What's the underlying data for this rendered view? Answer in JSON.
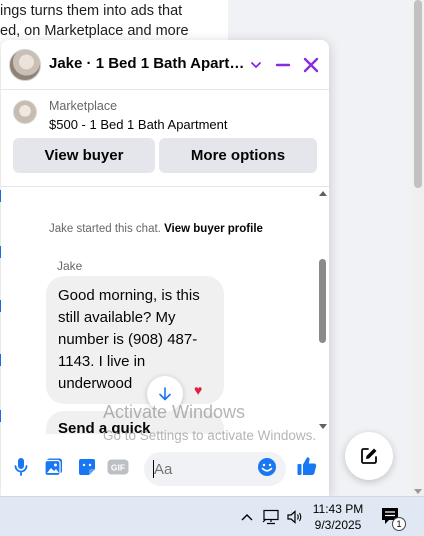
{
  "background": {
    "lines": [
      "ings turns them into ads that",
      "ed, on Marketplace and more"
    ]
  },
  "chat": {
    "title": "Jake · 1 Bed 1 Bath Apartm…",
    "listing": {
      "label": "Marketplace",
      "title": "$500 - 1 Bed 1 Bath Apartment"
    },
    "buttons": {
      "view_buyer": "View buyer",
      "more_options": "More options"
    },
    "system_text": "Jake started this chat.",
    "system_link": "View buyer profile",
    "sender": "Jake",
    "message": "Good morning, is this still available? My number is (908) 487-1143. I live in underwood",
    "reaction": "♥",
    "partial_message": "Send a quick",
    "composer_placeholder": "Aa",
    "accent_color": "#8a2be2",
    "blue": "#1877f2"
  },
  "watermark": {
    "line1": "Activate Windows",
    "line2": "Go to Settings to activate Windows."
  },
  "taskbar": {
    "time": "11:43 PM",
    "date": "9/3/2025",
    "notification_count": "1"
  }
}
